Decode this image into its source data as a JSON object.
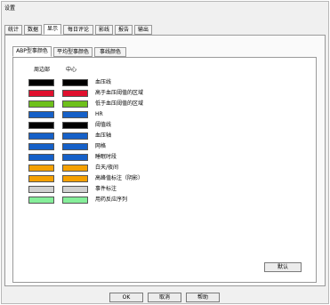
{
  "window": {
    "title": "设置"
  },
  "main_tabs": [
    "统计",
    "数据",
    "显示",
    "每日评论",
    "影线",
    "报告",
    "输出"
  ],
  "sub_tabs": [
    "ABP型事颜色",
    "平均型事颜色",
    "事线颜色"
  ],
  "columns": {
    "peripheral": "周边部",
    "center": "中心"
  },
  "rows": [
    {
      "label": "血压线",
      "peripheral_color": "#000000",
      "center_color": "#000000"
    },
    {
      "label": "高于血压阈值的区域",
      "peripheral_color": "#e0102e",
      "center_color": "#e0102e"
    },
    {
      "label": "低于血压阈值的区域",
      "peripheral_color": "#6ec01c",
      "center_color": "#6ec01c"
    },
    {
      "label": "HR",
      "peripheral_color": "#1560c8",
      "center_color": "#1560c8"
    },
    {
      "label": "阈值线",
      "peripheral_color": "#000000",
      "center_color": "#000000"
    },
    {
      "label": "血压轴",
      "peripheral_color": "#1560c8",
      "center_color": "#1560c8"
    },
    {
      "label": "网格",
      "peripheral_color": "#1560c8",
      "center_color": "#1560c8"
    },
    {
      "label": "睡眠时段",
      "peripheral_color": "#1560c8",
      "center_color": "#1560c8"
    },
    {
      "label": "白天/夜间",
      "peripheral_color": "#f5a000",
      "center_color": "#f5a000"
    },
    {
      "label": "高峰值标注（阴影）",
      "peripheral_color": "#f5a000",
      "center_color": "#f5a000"
    },
    {
      "label": "事件标注",
      "peripheral_color": "#d0d0d0",
      "center_color": "#d0d0d0"
    },
    {
      "label": "用药反应序列",
      "peripheral_color": "#86ee9a",
      "center_color": "#86ee9a"
    }
  ],
  "buttons": {
    "default": "默认",
    "ok": "OK",
    "cancel": "取消",
    "help": "帮助"
  }
}
